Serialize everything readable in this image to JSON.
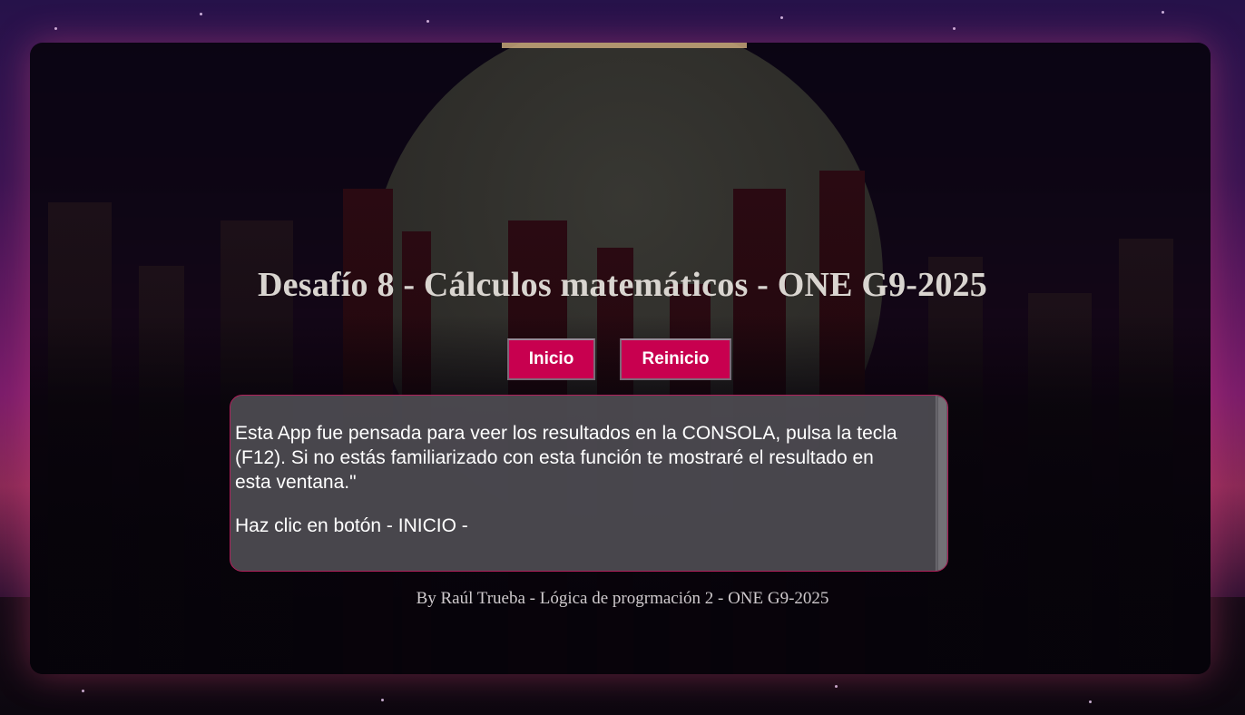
{
  "page": {
    "title": "Desafío 8 - Cálculos matemáticos - ONE G9-2025",
    "footer": "By Raúl Trueba - Lógica de progrmación 2 - ONE G9-2025"
  },
  "buttons": {
    "start_label": "Inicio",
    "restart_label": "Reinicio"
  },
  "output": {
    "paragraphs": [
      "Esta App fue pensada para veer los resultados en la CONSOLA, pulsa la tecla (F12). Si no estás familiarizado con esta función te mostraré el resultado en esta ventana.\"",
      "Haz clic en botón - INICIO -"
    ]
  },
  "colors": {
    "button_bg": "#c8004f",
    "output_border": "#b0205a",
    "title_text": "#d9d5d0"
  }
}
